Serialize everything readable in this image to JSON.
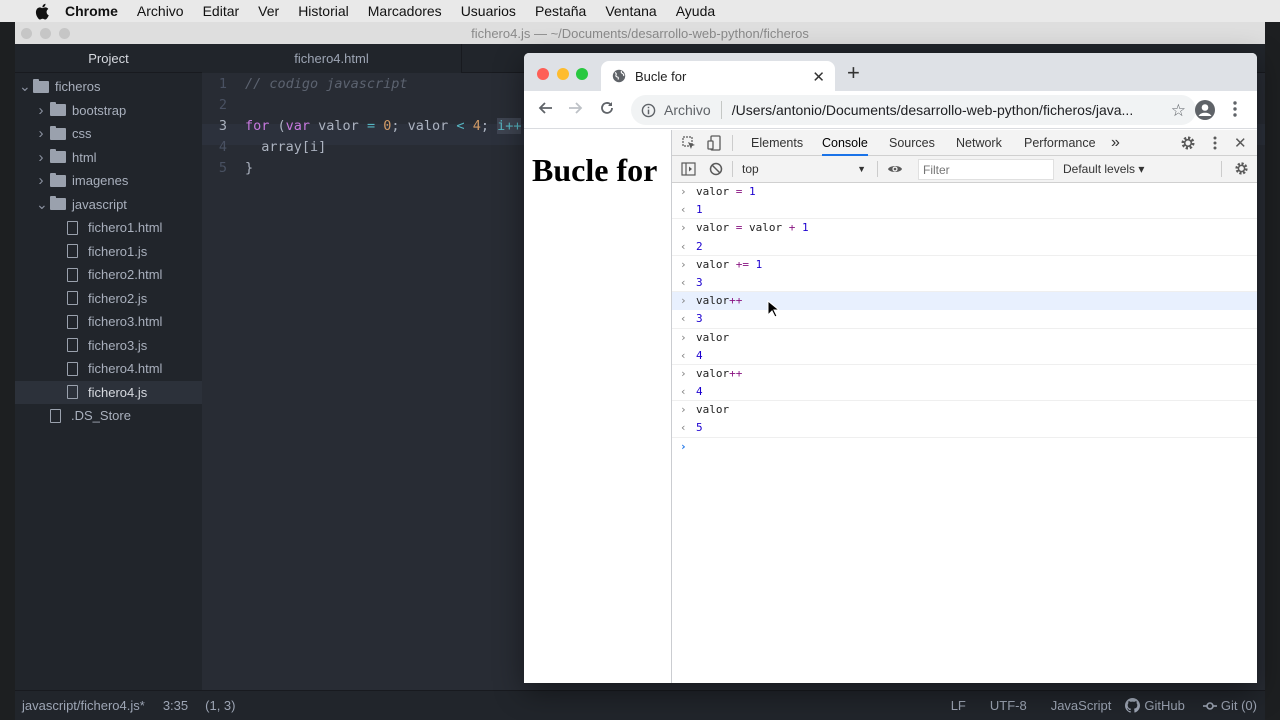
{
  "menubar": {
    "app": "Chrome",
    "items": [
      "Archivo",
      "Editar",
      "Ver",
      "Historial",
      "Marcadores",
      "Usuarios",
      "Pestaña",
      "Ventana",
      "Ayuda"
    ]
  },
  "atom": {
    "title": "fichero4.js — ~/Documents/desarrollo-web-python/ficheros",
    "tree_header": "Project",
    "tree": [
      {
        "label": "ficheros",
        "type": "folder",
        "open": true,
        "depth": 0
      },
      {
        "label": "bootstrap",
        "type": "folder",
        "open": false,
        "depth": 1
      },
      {
        "label": "css",
        "type": "folder",
        "open": false,
        "depth": 1
      },
      {
        "label": "html",
        "type": "folder",
        "open": false,
        "depth": 1
      },
      {
        "label": "imagenes",
        "type": "folder",
        "open": false,
        "depth": 1
      },
      {
        "label": "javascript",
        "type": "folder",
        "open": true,
        "depth": 1
      },
      {
        "label": "fichero1.html",
        "type": "file",
        "depth": 2
      },
      {
        "label": "fichero1.js",
        "type": "file",
        "depth": 2
      },
      {
        "label": "fichero2.html",
        "type": "file",
        "depth": 2
      },
      {
        "label": "fichero2.js",
        "type": "file",
        "depth": 2
      },
      {
        "label": "fichero3.html",
        "type": "file",
        "depth": 2
      },
      {
        "label": "fichero3.js",
        "type": "file",
        "depth": 2
      },
      {
        "label": "fichero4.html",
        "type": "file",
        "depth": 2
      },
      {
        "label": "fichero4.js",
        "type": "file",
        "depth": 2,
        "selected": true
      },
      {
        "label": ".DS_Store",
        "type": "file",
        "depth": 1
      }
    ],
    "tab": "fichero4.html",
    "code": {
      "line_numbers": [
        "1",
        "2",
        "3",
        "4",
        "5"
      ],
      "line1": "// codigo javascript",
      "line3_for": "for",
      "line3_open": " (",
      "line3_var": "var",
      "line3_a": " valor ",
      "line3_eq": "=",
      "line3_zero": "0",
      "line3_b": "; valor ",
      "line3_lt": "<",
      "line3_four": "4",
      "line3_c": "; ",
      "line3_sel": "i++",
      "line4": "  array[i]",
      "line5": "}"
    },
    "status": {
      "path": "javascript/fichero4.js*",
      "time": "3:35",
      "cursor": "(1, 3)",
      "eol": "LF",
      "encoding": "UTF-8",
      "grammar": "JavaScript",
      "github": "GitHub",
      "git": "Git (0)"
    }
  },
  "chrome": {
    "tab_title": "Bucle for",
    "url_scheme": "Archivo",
    "url": "/Users/antonio/Documents/desarrollo-web-python/ficheros/java...",
    "page_heading": "Bucle for",
    "devtools": {
      "tabs": [
        "Elements",
        "Console",
        "Sources",
        "Network",
        "Performance"
      ],
      "more": "»",
      "active_tab": "Console",
      "context": "top",
      "filter_placeholder": "Filter",
      "levels": "Default levels ▾"
    },
    "console": [
      {
        "kind": "input",
        "parts": [
          [
            "valor ",
            ""
          ],
          [
            "=",
            "op"
          ],
          [
            " ",
            ""
          ],
          [
            "1",
            "num"
          ]
        ]
      },
      {
        "kind": "result",
        "text": "1"
      },
      {
        "kind": "input",
        "parts": [
          [
            "valor ",
            ""
          ],
          [
            "=",
            "op"
          ],
          [
            " valor ",
            ""
          ],
          [
            "+",
            "op"
          ],
          [
            " ",
            ""
          ],
          [
            "1",
            "num"
          ]
        ]
      },
      {
        "kind": "result",
        "text": "2"
      },
      {
        "kind": "input",
        "parts": [
          [
            "valor ",
            ""
          ],
          [
            "+=",
            "op"
          ],
          [
            " ",
            ""
          ],
          [
            "1",
            "num"
          ]
        ]
      },
      {
        "kind": "result",
        "text": "3"
      },
      {
        "kind": "input",
        "parts": [
          [
            "valor",
            ""
          ],
          [
            "++",
            "op"
          ]
        ],
        "highlight": true
      },
      {
        "kind": "result",
        "text": "3"
      },
      {
        "kind": "input",
        "parts": [
          [
            "valor",
            ""
          ]
        ]
      },
      {
        "kind": "result",
        "text": "4"
      },
      {
        "kind": "input",
        "parts": [
          [
            "valor",
            ""
          ],
          [
            "++",
            "op"
          ]
        ]
      },
      {
        "kind": "result",
        "text": "4"
      },
      {
        "kind": "input",
        "parts": [
          [
            "valor",
            ""
          ]
        ]
      },
      {
        "kind": "result",
        "text": "5"
      }
    ],
    "input_arrow": "›",
    "result_arrow": "‹"
  }
}
